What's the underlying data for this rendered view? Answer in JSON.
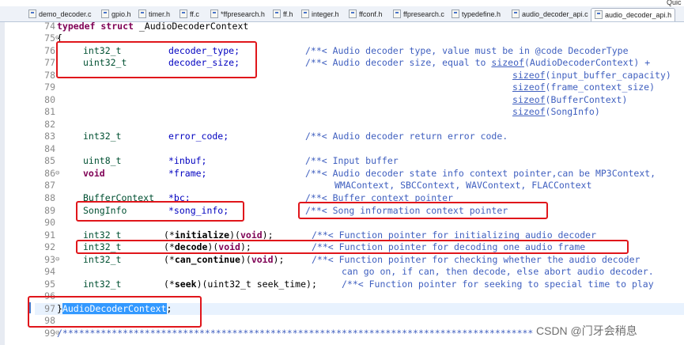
{
  "toolbar": {
    "quick_label": "Quic"
  },
  "tabs": [
    {
      "label": "demo_decoder.c",
      "active": false
    },
    {
      "label": "gpio.h",
      "active": false
    },
    {
      "label": "timer.h",
      "active": false
    },
    {
      "label": "ff.c",
      "active": false
    },
    {
      "label": "*ffpresearch.h",
      "active": false
    },
    {
      "label": "ff.h",
      "active": false
    },
    {
      "label": "integer.h",
      "active": false
    },
    {
      "label": "ffconf.h",
      "active": false
    },
    {
      "label": "ffpresearch.c",
      "active": false
    },
    {
      "label": "typedefine.h",
      "active": false
    },
    {
      "label": "audio_decoder_api.c",
      "active": false
    },
    {
      "label": "audio_decoder_api.h",
      "active": true
    }
  ],
  "code": {
    "l74": {
      "num": "74",
      "kw": "typedef struct",
      "name": " _AudioDecoderContext"
    },
    "l75": {
      "num": "75",
      "text": "{"
    },
    "l76": {
      "num": "76",
      "type": "int32_t",
      "var": "decoder_type;",
      "cmt": "/**< Audio decoder type, value must be in @code DecoderType"
    },
    "l77": {
      "num": "77",
      "type": "uint32_t",
      "var": "decoder_size;",
      "cmt": "/**< Audio decoder size, equal to ",
      "lnk": "sizeof",
      "cmt2": "(AudioDecoderContext) +"
    },
    "l78": {
      "num": "78",
      "lnk": "sizeof",
      "cmt": "(input_buffer_capacity)"
    },
    "l79": {
      "num": "79",
      "lnk": "sizeof",
      "cmt": "(frame_context_size)"
    },
    "l80": {
      "num": "80",
      "lnk": "sizeof",
      "cmt": "(BufferContext)"
    },
    "l81": {
      "num": "81",
      "lnk": "sizeof",
      "cmt": "(SongInfo)"
    },
    "l82": {
      "num": "82"
    },
    "l83": {
      "num": "83",
      "type": "int32_t",
      "var": "error_code;",
      "cmt": "/**< Audio decoder return error code."
    },
    "l84": {
      "num": "84"
    },
    "l85": {
      "num": "85",
      "type": "uint8_t",
      "var": "*inbuf;",
      "cmt": "/**< Input buffer"
    },
    "l86": {
      "num": "86",
      "type": "void",
      "var": "*frame;",
      "cmt": "/**< Audio decoder state info context pointer,can be MP3Context,"
    },
    "l87": {
      "num": "87",
      "cmt": "WMAContext, SBCContext, WAVContext, FLACContext"
    },
    "l88": {
      "num": "88",
      "type": "BufferContext",
      "var": "*bc;",
      "cmt": "/**< Buffer context pointer"
    },
    "l89": {
      "num": "89",
      "type": "SongInfo",
      "var": "*song_info;",
      "cmt": "/**< Song information context pointer"
    },
    "l90": {
      "num": "90"
    },
    "l91": {
      "num": "91",
      "type": "int32_t",
      "pre": "(*",
      "fn": "initialize",
      "post": ")(",
      "kw": "void",
      "end": ");",
      "cmt": "/**< Function pointer for initializing audio decoder"
    },
    "l92": {
      "num": "92",
      "type": "int32_t",
      "pre": "(*",
      "fn": "decode",
      "post": ")(",
      "kw": "void",
      "end": ");",
      "cmt": "/**< Function pointer for decoding one audio frame"
    },
    "l93": {
      "num": "93",
      "type": "int32_t",
      "pre": "(*",
      "fn": "can_continue",
      "post": ")(",
      "kw": "void",
      "end": ");",
      "cmt": "/**< Function pointer for checking whether the audio decoder"
    },
    "l94": {
      "num": "94",
      "cmt": "can go on, if can, then decode, else abort audio decoder."
    },
    "l95": {
      "num": "95",
      "type": "int32_t",
      "pre": "(*",
      "fn": "seek",
      "post": ")(uint32_t seek_time);",
      "cmt": "/**< Function pointer for seeking to special time to play"
    },
    "l96": {
      "num": "96"
    },
    "l97": {
      "num": "97",
      "brace": "}",
      "sel": "AudioDecoderContext",
      "end": ";"
    },
    "l98": {
      "num": "98"
    },
    "l99": {
      "num": "99",
      "cmt": "/**************************************************************************************"
    }
  },
  "watermark": "CSDN @门牙会稍息"
}
